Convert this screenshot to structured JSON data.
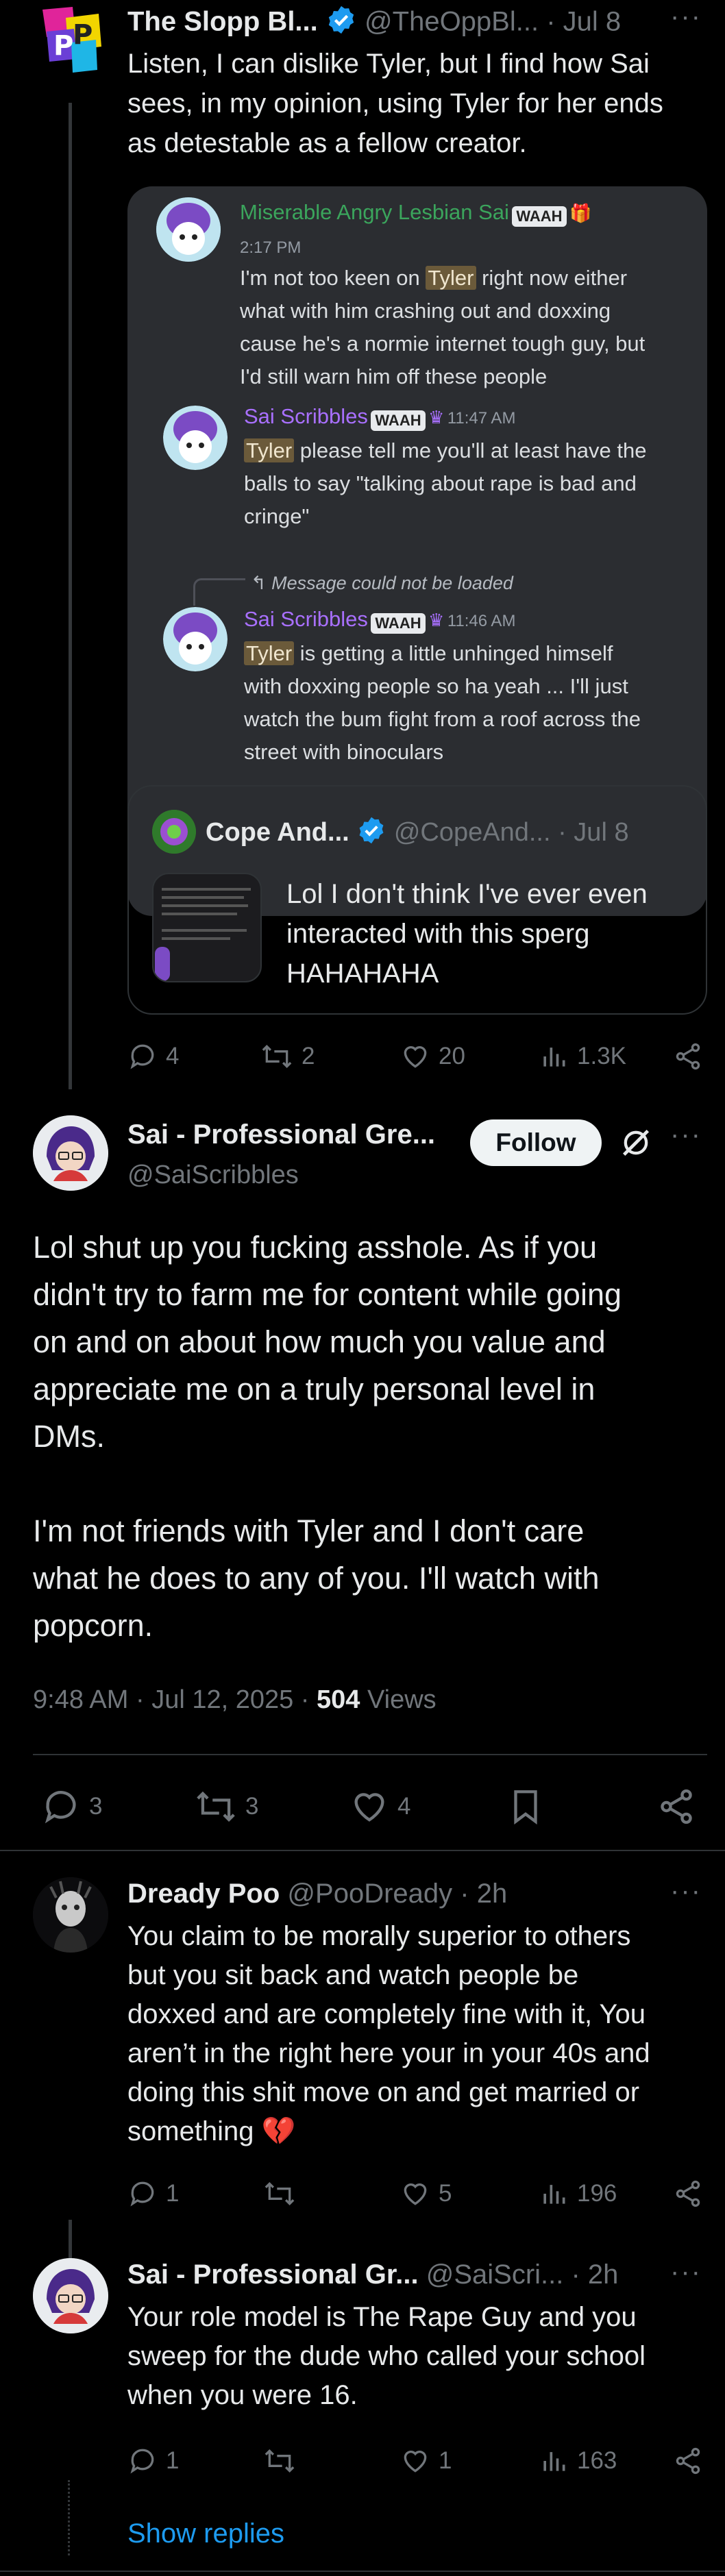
{
  "tweet1": {
    "name": "The Slopp Bl...",
    "handle": "@TheOppBl...",
    "time": "· Jul 8",
    "text_lines": [
      "Listen, I can dislike Tyler, but I find how Sai",
      "sees, in my opinion, using Tyler for her ends",
      "as detestable as a fellow creator."
    ],
    "discord": {
      "msg1": {
        "author": "Miserable Angry Lesbian Sai",
        "badge": "WAAH",
        "time": "2:17 PM",
        "lines": [
          "I'm not too keen on ",
          "Tyler",
          " right now either",
          "what with him crashing out and doxxing",
          "cause he's a normie internet tough guy, but",
          "I'd still warn him off these people"
        ]
      },
      "msg2": {
        "author": "Sai Scribbles",
        "badge": "WAAH",
        "time": "11:47 AM",
        "lines": [
          "Tyler",
          " please tell me you'll at least have the",
          "balls to say \"talking about rape is bad and",
          "cringe\""
        ]
      },
      "msg3": {
        "reply_note": "Message could not be loaded",
        "author": "Sai Scribbles",
        "badge": "WAAH",
        "time": "11:46 AM",
        "lines": [
          "Tyler",
          " is getting a little unhinged himself",
          "with doxxing people so ha yeah ... I'll just",
          "watch the bum fight from a roof across the",
          "street with binoculars"
        ]
      }
    },
    "quote": {
      "name": "Cope And...",
      "handle": "@CopeAnd...",
      "time": "· Jul 8",
      "text_lines": [
        "Lol I don't think I've ever even",
        "interacted with this sperg",
        "HAHAHAHA"
      ]
    },
    "stats": {
      "replies": "4",
      "reposts": "2",
      "likes": "20",
      "views": "1.3K"
    }
  },
  "main": {
    "name": "Sai - Professional Gre...",
    "handle": "@SaiScribbles",
    "follow_label": "Follow",
    "para1": [
      "Lol shut up you fucking asshole. As if you",
      "didn't try to farm me for content while going",
      "on and on about how much you value and",
      "appreciate me on a truly personal level in",
      "DMs."
    ],
    "para2": [
      "I'm not friends with Tyler and I don't care",
      "what he does to any of you. I'll watch with",
      "popcorn."
    ],
    "timestamp": "9:48 AM · Jul 12, 2025 · ",
    "views_count": "504",
    "views_label": " Views",
    "stats": {
      "replies": "3",
      "reposts": "3",
      "likes": "4"
    }
  },
  "reply1": {
    "name": "Dready Poo",
    "handle": "@PooDready",
    "time": "· 2h",
    "text_lines": [
      "You claim to be morally superior to others",
      "but you sit back and watch people be",
      "doxxed and are completely fine with it, You",
      "aren’t in the right here your in your 40s and",
      "doing this shit move on and get married or",
      "something"
    ],
    "emoji": "💔",
    "stats": {
      "replies": "1",
      "likes": "5",
      "views": "196"
    }
  },
  "reply2": {
    "name": "Sai - Professional Gr...",
    "handle": "@SaiScri...",
    "time": "· 2h",
    "text_lines": [
      "Your role model is The Rape Guy and you",
      "sweep for the dude who called your school",
      "when you were 16."
    ],
    "stats": {
      "replies": "1",
      "likes": "1",
      "views": "163"
    },
    "show_replies": "Show replies"
  },
  "colors": {
    "accent": "#1d9bf0",
    "background": "#000000",
    "muted": "#71767b",
    "discord_bg": "#2b2d31",
    "discord_green": "#3ba55c",
    "discord_purple": "#a970ff"
  }
}
